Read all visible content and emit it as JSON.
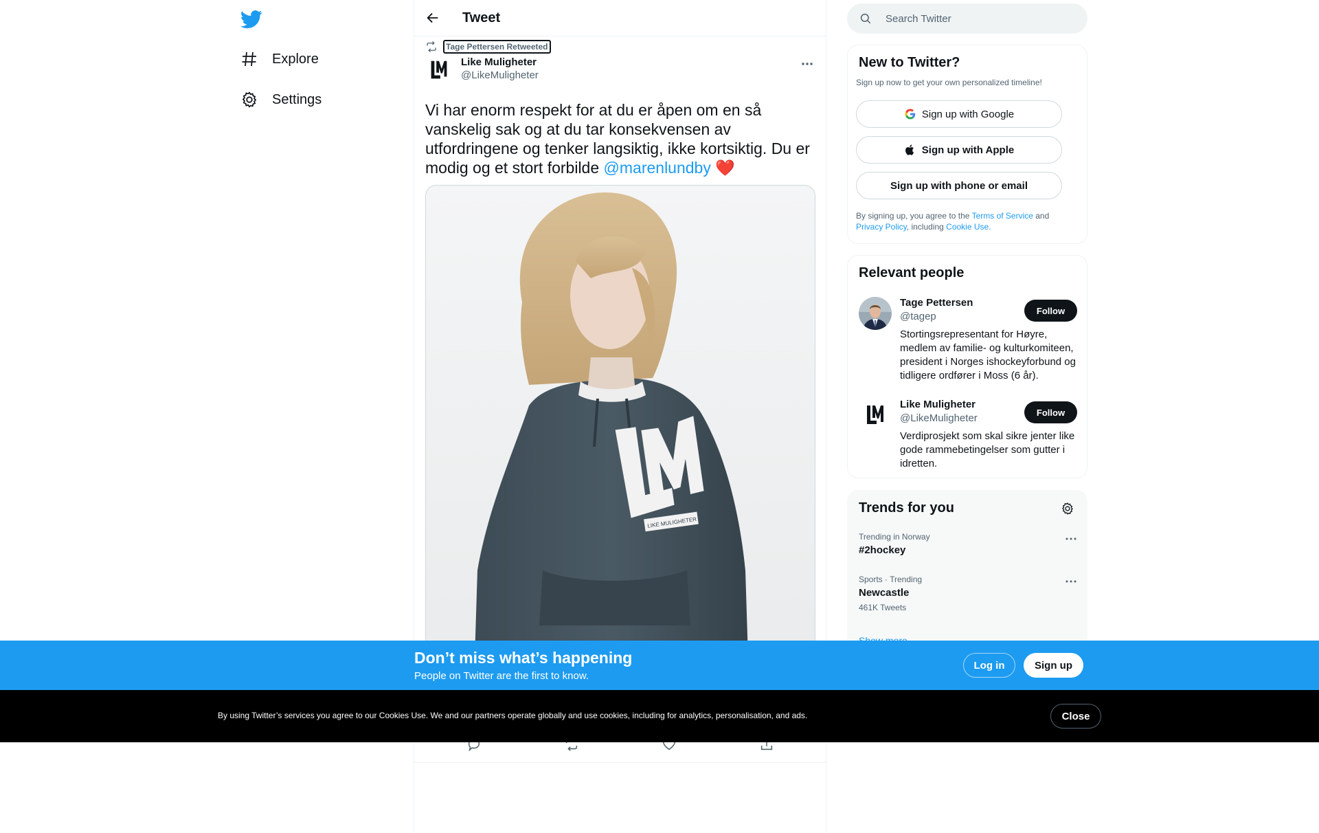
{
  "nav": {
    "logo_icon": "twitter-bird-icon",
    "items": [
      {
        "label": "Explore",
        "icon": "hashtag-icon"
      },
      {
        "label": "Settings",
        "icon": "gear-icon"
      }
    ]
  },
  "header": {
    "title": "Tweet",
    "back_icon": "arrow-left-icon"
  },
  "tweet": {
    "retweeted_by": "Tage Pettersen Retweeted",
    "author_name": "Like Muligheter",
    "author_handle": "@LikeMuligheter",
    "text": "Vi har enorm respekt for at du er åpen om en så vanskelig sak og at du tar konsekvensen av utfordringene og tenker langsiktig, ikke kortsiktig. Du er modig og et stort forbilde ",
    "mention": "@marenlundby",
    "emoji": "❤️",
    "hoodie_text": "LIKE MULIGHETER",
    "actions": [
      "reply-icon",
      "retweet-icon",
      "like-icon",
      "share-icon"
    ]
  },
  "search": {
    "placeholder": "Search Twitter"
  },
  "signup": {
    "title": "New to Twitter?",
    "subtitle": "Sign up now to get your own personalized timeline!",
    "google": "Sign up with Google",
    "apple": "Sign up with Apple",
    "phone": "Sign up with phone or email",
    "legal_1": "By signing up, you agree to the ",
    "terms": "Terms of Service",
    "legal_2": " and ",
    "privacy": "Privacy Policy",
    "legal_3": ", including ",
    "cookie": "Cookie Use."
  },
  "people": {
    "title": "Relevant people",
    "list": [
      {
        "name": "Tage Pettersen",
        "handle": "@tagep",
        "bio": "Stortingsrepresentant for Høyre, medlem av familie- og kulturkomiteen, president i Norges ishockeyforbund og tidligere ordfører i Moss (6 år).",
        "follow": "Follow"
      },
      {
        "name": "Like Muligheter",
        "handle": "@LikeMuligheter",
        "bio": "Verdiprosjekt som skal sikre jenter like gode rammebetingelser som gutter i idretten.",
        "follow": "Follow"
      }
    ]
  },
  "trends": {
    "title": "Trends for you",
    "list": [
      {
        "meta": "Trending in Norway",
        "name": "#2hockey",
        "count": ""
      },
      {
        "meta": "Sports · Trending",
        "name": "Newcastle",
        "count": "461K Tweets"
      }
    ],
    "show_more": "Show more"
  },
  "banner": {
    "title": "Don’t miss what’s happening",
    "subtitle": "People on Twitter are the first to know.",
    "login": "Log in",
    "signup": "Sign up"
  },
  "cookie_bar": {
    "text": "By using Twitter’s services you agree to our Cookies Use. We and our partners operate globally and use cookies, including for analytics, personalisation, and ads.",
    "close": "Close"
  },
  "colors": {
    "accent": "#1d9bf0",
    "text": "#0f1419",
    "muted": "#536471",
    "cookie_bg": "#000000"
  }
}
